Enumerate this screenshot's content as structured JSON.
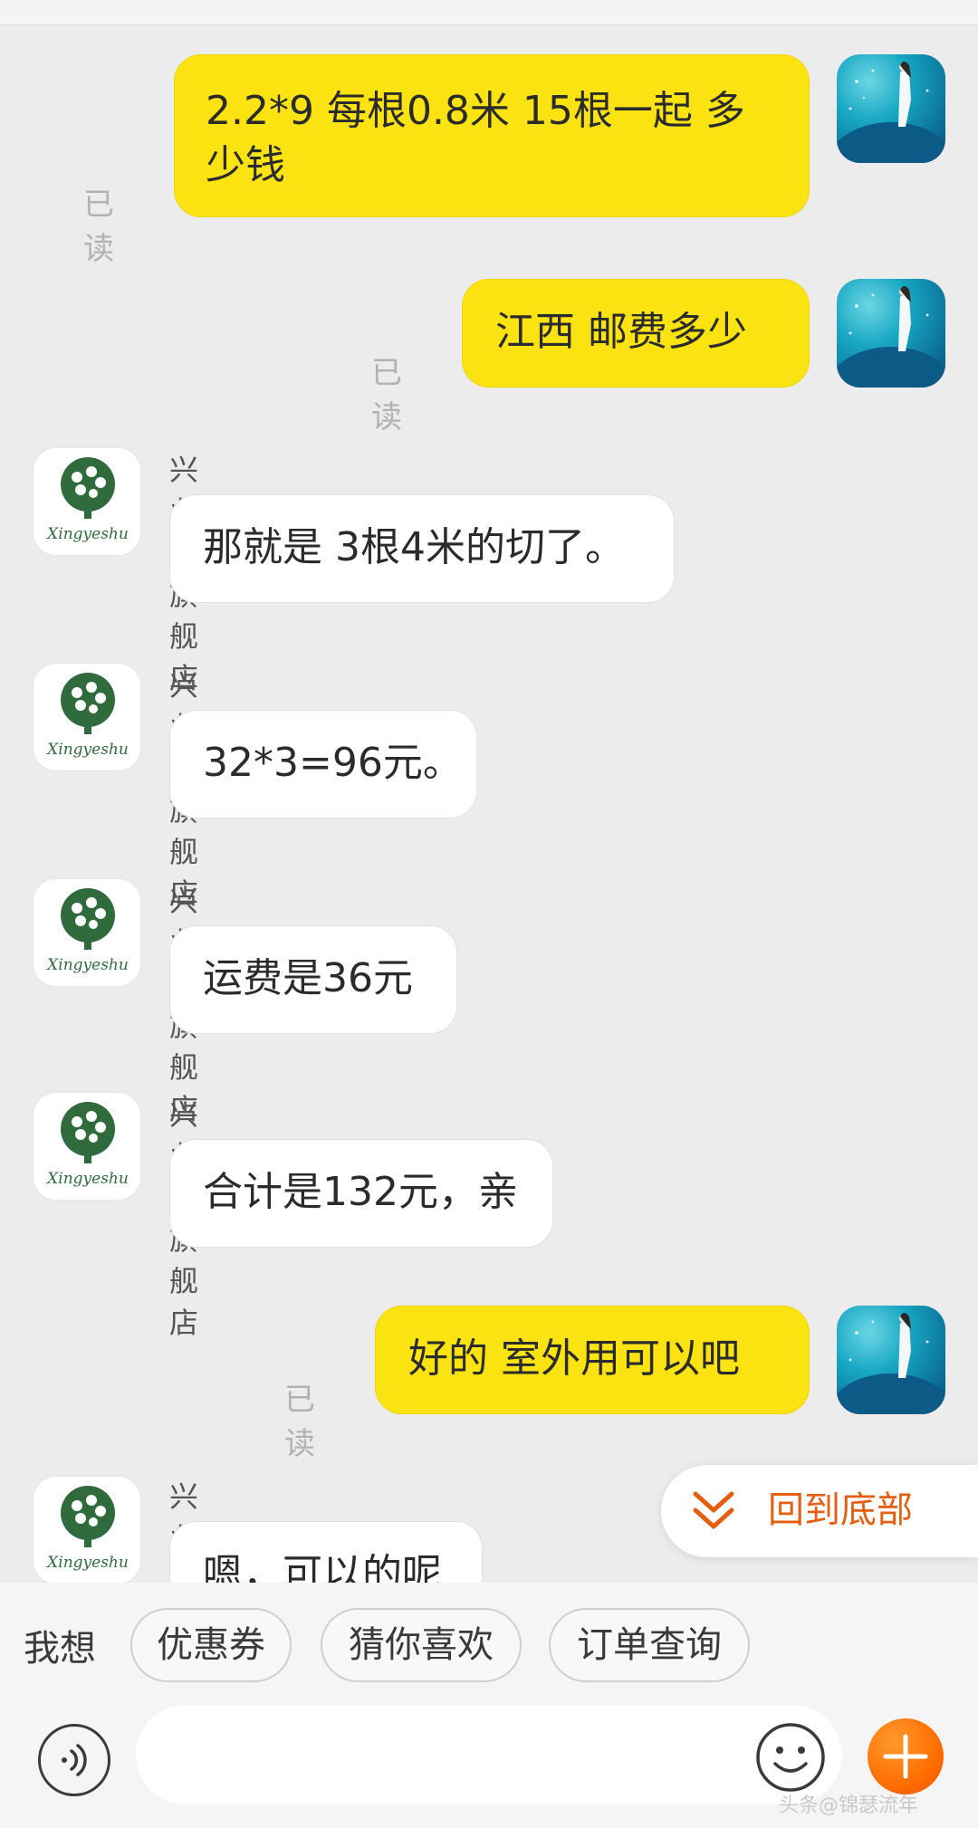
{
  "messages": [
    {
      "from": "me",
      "text_line1": "2.2*9 每根0.8米 15根一起  多",
      "text_line2": "少钱",
      "read": "已读"
    },
    {
      "from": "me",
      "text": "江西  邮费多少",
      "read": "已读"
    },
    {
      "from": "shop",
      "sender": "兴业树旗舰店",
      "text": "那就是 3根4米的切了。"
    },
    {
      "from": "shop",
      "sender": "兴业树旗舰店",
      "text": "32*3=96元。"
    },
    {
      "from": "shop",
      "sender": "兴业树旗舰店",
      "text": "运费是36元"
    },
    {
      "from": "shop",
      "sender": "兴业树旗舰店",
      "text": "合计是132元，亲"
    },
    {
      "from": "me",
      "text": "好的  室外用可以吧",
      "read": "已读"
    },
    {
      "from": "shop",
      "sender": "兴业树旗舰店",
      "text": "嗯，可以的呢"
    }
  ],
  "shop_avatar_text": "Xingyeshu",
  "back_to_bottom": {
    "label": "回到底部",
    "icon": "double-chevron-down-icon"
  },
  "quick_replies": {
    "label": "我想",
    "chips": [
      "优惠券",
      "猜你喜欢",
      "订单查询"
    ]
  },
  "input": {
    "placeholder": "",
    "voice_icon": "voice-icon",
    "emoji_icon": "emoji-icon",
    "plus_icon": "plus-icon"
  },
  "watermark": "头条@锦瑟流年",
  "colors": {
    "out_bubble": "#fbe311",
    "in_bubble": "#ffffff",
    "accent": "#ff6a00",
    "back_to_bottom_text": "#e45f12",
    "background": "#ececec"
  }
}
